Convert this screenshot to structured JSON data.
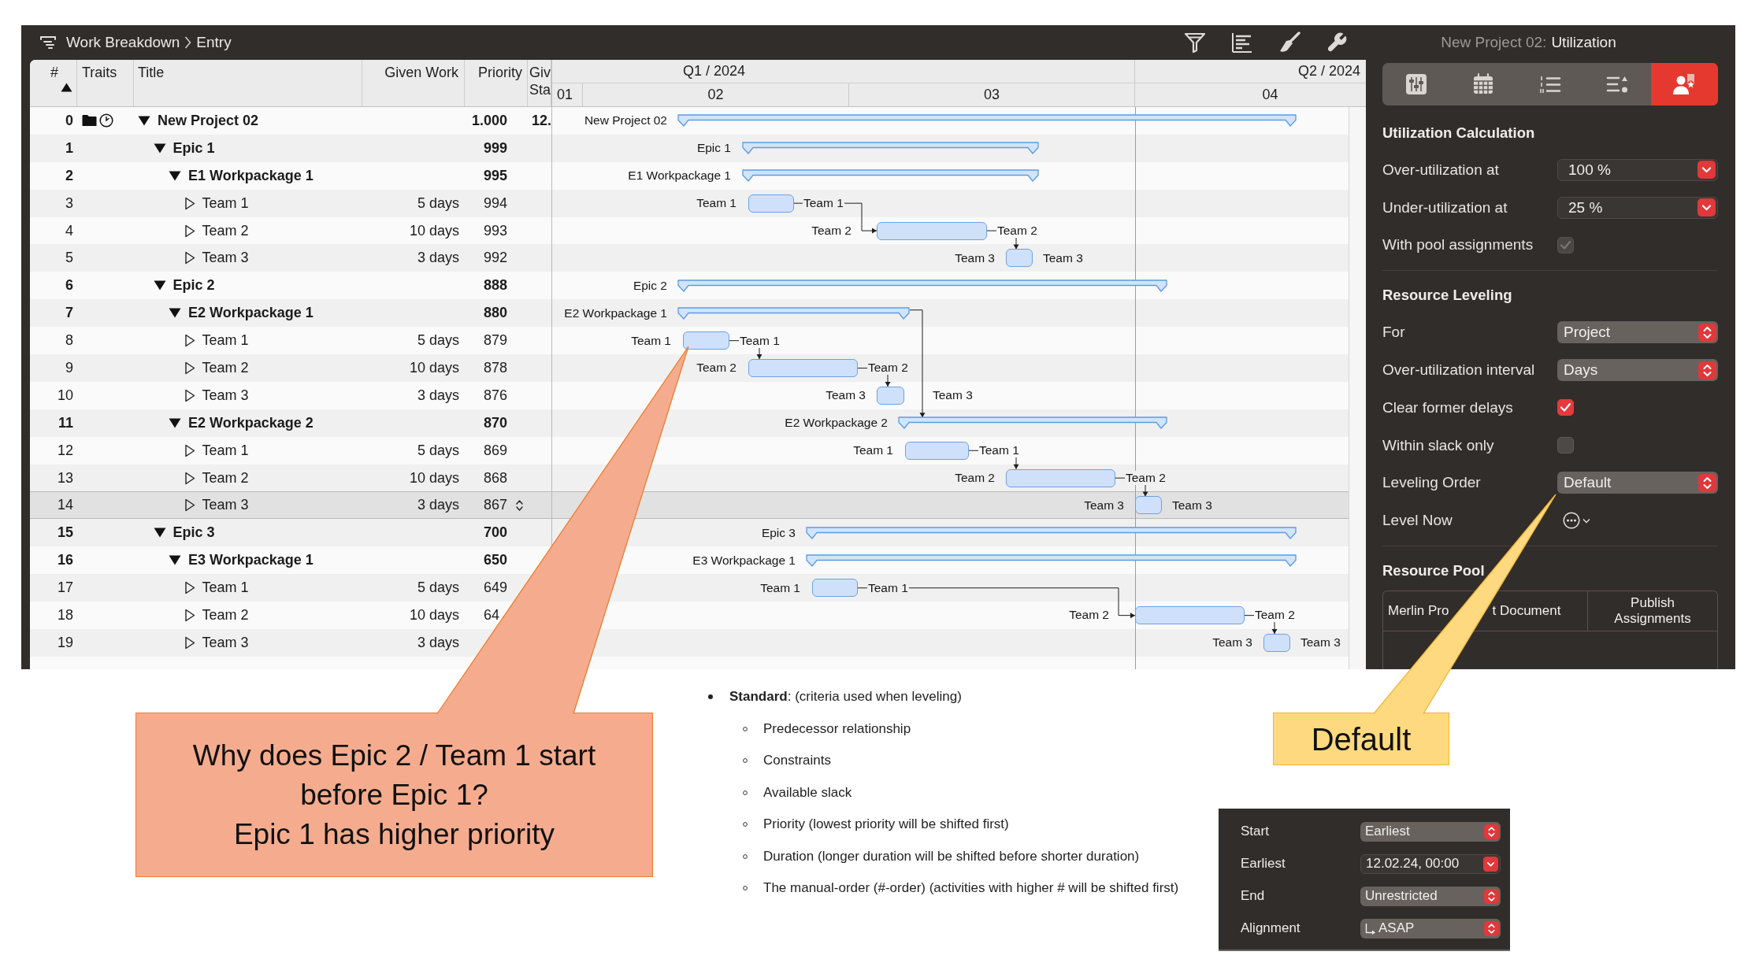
{
  "window": {
    "breadcrumb": [
      "Work Breakdown",
      "Entry"
    ]
  },
  "table": {
    "columns": [
      {
        "label": "#",
        "sorted": true
      },
      {
        "label": "Traits",
        "sorted": false
      },
      {
        "label": "Title",
        "sorted": false
      },
      {
        "label": "Given Work",
        "sorted": false
      },
      {
        "label": "Priority",
        "sorted": false
      },
      {
        "label": "Giv Sta",
        "sorted": false
      }
    ],
    "rows": [
      {
        "kind": "project",
        "number": "0",
        "title": "New Project 02",
        "priority": "1.000",
        "given_start": "12.",
        "expanded": true,
        "selected": false,
        "children": [
          {
            "kind": "summary",
            "number": "1",
            "title": "Epic 1",
            "priority": "999",
            "expanded": true,
            "selected": false,
            "children": [
              {
                "kind": "summary",
                "number": "2",
                "title": "E1 Workpackage 1",
                "priority": "995",
                "expanded": true,
                "selected": false,
                "children": [
                  {
                    "kind": "task",
                    "number": "3",
                    "title": "Team 1",
                    "given_work": "5 days",
                    "priority": "994",
                    "expanded": false,
                    "selected": false
                  },
                  {
                    "kind": "task",
                    "number": "4",
                    "title": "Team 2",
                    "given_work": "10 days",
                    "priority": "993",
                    "expanded": false,
                    "selected": false
                  },
                  {
                    "kind": "task",
                    "number": "5",
                    "title": "Team 3",
                    "given_work": "3 days",
                    "priority": "992",
                    "expanded": false,
                    "selected": false
                  }
                ]
              }
            ]
          },
          {
            "kind": "summary",
            "number": "6",
            "title": "Epic 2",
            "priority": "888",
            "expanded": true,
            "selected": false,
            "children": [
              {
                "kind": "summary",
                "number": "7",
                "title": "E2 Workpackage 1",
                "priority": "880",
                "expanded": true,
                "selected": false,
                "children": [
                  {
                    "kind": "task",
                    "number": "8",
                    "title": "Team 1",
                    "given_work": "5 days",
                    "priority": "879",
                    "expanded": false,
                    "selected": false
                  },
                  {
                    "kind": "task",
                    "number": "9",
                    "title": "Team 2",
                    "given_work": "10 days",
                    "priority": "878",
                    "expanded": false,
                    "selected": false
                  },
                  {
                    "kind": "task",
                    "number": "10",
                    "title": "Team 3",
                    "given_work": "3 days",
                    "priority": "876",
                    "expanded": false,
                    "selected": false
                  }
                ]
              },
              {
                "kind": "summary",
                "number": "11",
                "title": "E2 Workpackage 2",
                "priority": "870",
                "expanded": true,
                "selected": false,
                "children": [
                  {
                    "kind": "task",
                    "number": "12",
                    "title": "Team 1",
                    "given_work": "5 days",
                    "priority": "869",
                    "expanded": false,
                    "selected": false
                  },
                  {
                    "kind": "task",
                    "number": "13",
                    "title": "Team 2",
                    "given_work": "10 days",
                    "priority": "868",
                    "expanded": false,
                    "selected": false
                  },
                  {
                    "kind": "task",
                    "number": "14",
                    "title": "Team 3",
                    "given_work": "3 days",
                    "priority": "867",
                    "expanded": false,
                    "selected": true
                  }
                ]
              }
            ]
          },
          {
            "kind": "summary",
            "number": "15",
            "title": "Epic 3",
            "priority": "700",
            "expanded": true,
            "selected": false,
            "children": [
              {
                "kind": "summary",
                "number": "16",
                "title": "E3 Workpackage 1",
                "priority": "650",
                "expanded": true,
                "selected": false,
                "children": [
                  {
                    "kind": "task",
                    "number": "17",
                    "title": "Team 1",
                    "given_work": "5 days",
                    "priority": "649",
                    "expanded": false,
                    "selected": false
                  },
                  {
                    "kind": "task",
                    "number": "18",
                    "title": "Team 2",
                    "given_work": "10 days",
                    "priority": "64",
                    "expanded": false,
                    "selected": false
                  },
                  {
                    "kind": "task",
                    "number": "19",
                    "title": "Team 3",
                    "given_work": "3 days",
                    "expanded": false,
                    "selected": false
                  }
                ]
              }
            ]
          }
        ]
      }
    ]
  },
  "gantt": {
    "quarters": [
      "Q1 / 2024",
      "Q2 / 2024"
    ],
    "months": [
      "01",
      "02",
      "03",
      "04"
    ],
    "rows": [
      {
        "kind": "summary",
        "label": "New Project 02"
      },
      {
        "kind": "summary",
        "label": "Epic 1"
      },
      {
        "kind": "summary",
        "label": "E1 Workpackage 1"
      },
      {
        "kind": "task",
        "label": "Team 1",
        "end_label": "Team 1"
      },
      {
        "kind": "task",
        "label": "Team 2",
        "end_label": "Team 2"
      },
      {
        "kind": "task",
        "label": "Team 3",
        "end_label": "Team 3"
      },
      {
        "kind": "summary",
        "label": "Epic 2"
      },
      {
        "kind": "summary",
        "label": "E2 Workpackage 1"
      },
      {
        "kind": "task",
        "label": "Team 1",
        "end_label": "Team 1"
      },
      {
        "kind": "task",
        "label": "Team 2",
        "end_label": "Team 2"
      },
      {
        "kind": "task",
        "label": "Team 3",
        "end_label": "Team 3"
      },
      {
        "kind": "summary",
        "label": "E2 Workpackage 2"
      },
      {
        "kind": "task",
        "label": "Team 1",
        "end_label": "Team 1"
      },
      {
        "kind": "task",
        "label": "Team 2",
        "end_label": "Team 2"
      },
      {
        "kind": "task",
        "label": "Team 3",
        "end_label": "Team 3"
      },
      {
        "kind": "summary",
        "label": "Epic 3"
      },
      {
        "kind": "summary",
        "label": "E3 Workpackage 1"
      },
      {
        "kind": "task",
        "label": "Team 1",
        "end_label": "Team 1"
      },
      {
        "kind": "task",
        "label": "Team 2",
        "end_label": "Team 2"
      },
      {
        "kind": "task",
        "label": "Team 3",
        "end_label": "Team 3"
      }
    ]
  },
  "inspector": {
    "document": "New Project 02:",
    "title": "Utilization",
    "tabs": [
      {
        "selected": false
      },
      {
        "selected": false
      },
      {
        "selected": false
      },
      {
        "selected": false
      },
      {
        "selected": true
      }
    ],
    "sections": [
      {
        "title": "Utilization Calculation",
        "fields": [
          {
            "kind": "combo",
            "label": "Over-utilization at",
            "value": "100 %"
          },
          {
            "kind": "combo",
            "label": "Under-utilization at",
            "value": "25 %"
          },
          {
            "kind": "checkbox",
            "label": "With pool assignments",
            "checked": true,
            "disabled": true
          }
        ]
      },
      {
        "title": "Resource Leveling",
        "fields": [
          {
            "kind": "popup",
            "label": "For",
            "value": "Project"
          },
          {
            "kind": "popup",
            "label": "Over-utilization interval",
            "value": "Days"
          },
          {
            "kind": "checkbox",
            "label": "Clear former delays",
            "checked": true,
            "disabled": false
          },
          {
            "kind": "checkbox",
            "label": "Within slack only",
            "checked": false,
            "disabled": false
          },
          {
            "kind": "popup",
            "label": "Leveling Order",
            "value": "Default"
          },
          {
            "kind": "menu",
            "label": "Level Now"
          }
        ]
      },
      {
        "title": "Resource Pool",
        "table": {
          "columns": [
            {
              "parts": [
                "Merlin Pro",
                "t Document"
              ]
            },
            {
              "parts": [
                "Publish Assignments"
              ]
            }
          ]
        }
      }
    ]
  },
  "callouts": [
    {
      "color": "#f5ac8e",
      "text": "Why does Epic 2 / Team 1 start before Epic 1?\nEpic 1 has higher priority"
    },
    {
      "color": "#ffd97f",
      "text": "Default"
    }
  ],
  "notes": {
    "heading": "**Standard**: (criteria used when leveling)",
    "items": [
      "Predecessor relationship",
      "Constraints",
      "Available slack",
      "Priority (lowest priority will be shifted first)",
      "Duration (longer duration will be shifted before shorter duration)",
      "The manual-order (#-order) (activities with higher # will be shifted first)"
    ]
  },
  "constraints": {
    "fields": [
      {
        "kind": "popup",
        "label": "Start",
        "value": "Earliest"
      },
      {
        "kind": "combo",
        "label": "Earliest",
        "value": "12.02.24, 00:00"
      },
      {
        "kind": "popup",
        "label": "End",
        "value": "Unrestricted"
      },
      {
        "kind": "alignment",
        "label": "Alignment",
        "value": "ASAP"
      }
    ]
  }
}
